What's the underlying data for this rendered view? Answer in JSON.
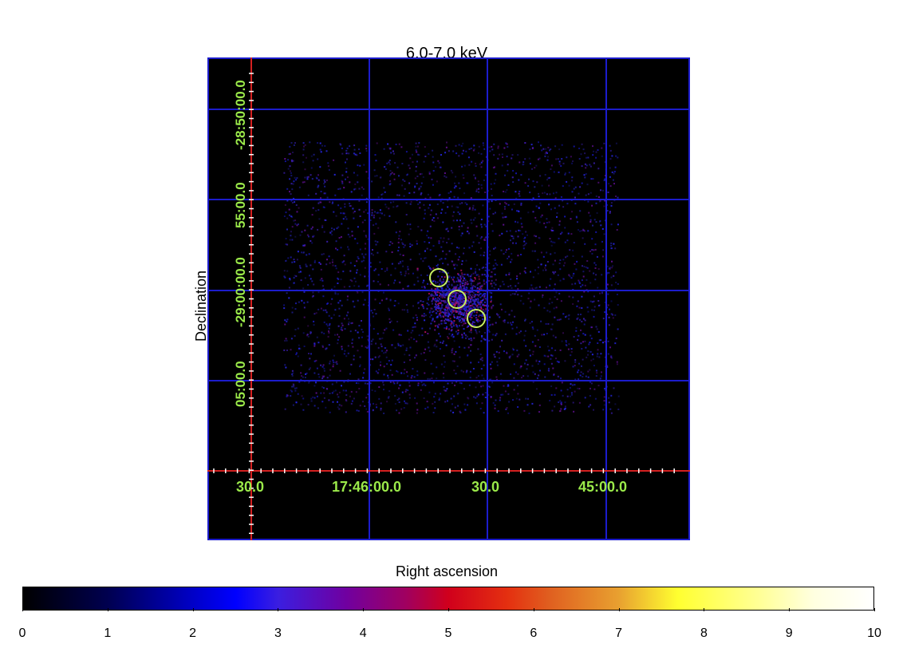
{
  "image": {
    "title": "6.0-7.0 keV",
    "x_axis_title": "Right ascension",
    "y_axis_title": "Declination",
    "dec_ticks": [
      "-28:50:00.0",
      "55:00.0",
      "-29:00:00.0",
      "05:00.0"
    ],
    "ra_ticks": [
      "30.0",
      "17:46:00.0",
      "30.0",
      "45:00.0"
    ],
    "grid_color": "#1c1ccc",
    "axis_color": "#d42020",
    "label_color": "#9bea4a",
    "region_color": "#c8f060"
  },
  "colorbar": {
    "ticks": [
      "0",
      "1",
      "2",
      "3",
      "4",
      "5",
      "6",
      "7",
      "8",
      "9",
      "10"
    ],
    "min": 0,
    "max": 10
  }
}
